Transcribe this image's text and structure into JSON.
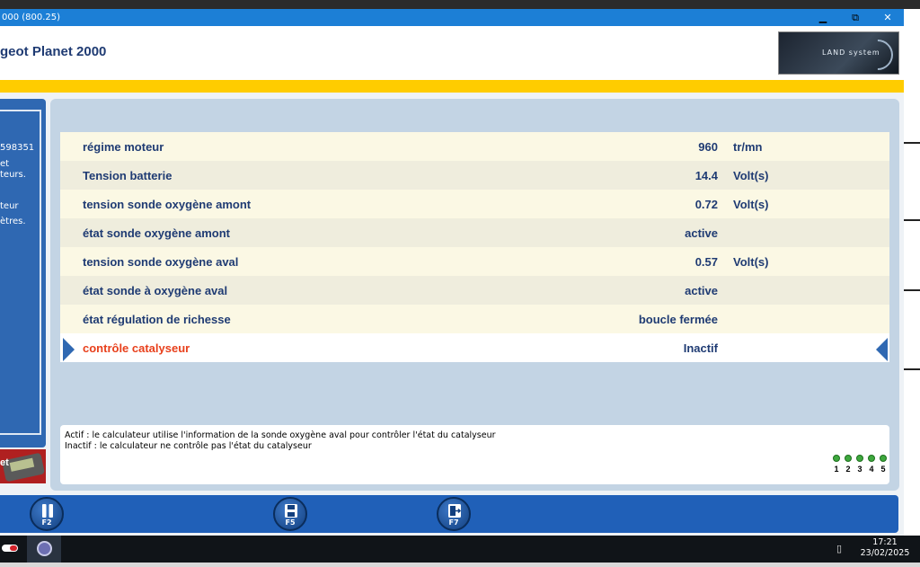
{
  "window": {
    "title": "000 (800.25)",
    "controls": {
      "minimize": "▁",
      "restore": "⧉",
      "close": "✕"
    }
  },
  "header": {
    "app_title": "geot Planet 2000",
    "logo_text": "LAND system"
  },
  "sidebar": {
    "lines": [
      "598351",
      "et",
      "teurs.",
      "",
      "teur",
      "ètres."
    ],
    "device_label": "et"
  },
  "table": {
    "rows": [
      {
        "label": "régime moteur",
        "value": "960",
        "unit": "tr/mn"
      },
      {
        "label": "Tension batterie",
        "value": "14.4",
        "unit": "Volt(s)"
      },
      {
        "label": "tension sonde oxygène amont",
        "value": "0.72",
        "unit": "Volt(s)"
      },
      {
        "label": "état sonde oxygène amont",
        "value": "active",
        "unit": ""
      },
      {
        "label": "tension sonde oxygène aval",
        "value": "0.57",
        "unit": "Volt(s)"
      },
      {
        "label": "état sonde à oxygène aval",
        "value": "active",
        "unit": ""
      },
      {
        "label": "état régulation de richesse",
        "value": "boucle fermée",
        "unit": ""
      },
      {
        "label": "contrôle catalyseur",
        "value": "Inactif",
        "unit": "",
        "selected": true
      }
    ]
  },
  "info": {
    "line1": "Actif : le calculateur utilise l'information de la sonde oxygène aval pour contrôler l'état du catalyseur",
    "line2": "Inactif : le calculateur ne contrôle pas l'état du catalyseur",
    "steps": [
      "1",
      "2",
      "3",
      "4",
      "5"
    ]
  },
  "footer": {
    "keys": [
      {
        "label": "F2",
        "icon": "pause-icon"
      },
      {
        "label": "F5",
        "icon": "save-disk-icon"
      },
      {
        "label": "F7",
        "icon": "exit-door-icon"
      }
    ]
  },
  "taskbar": {
    "time": "17:21",
    "date": "23/02/2025"
  },
  "colors": {
    "titlebar": "#1c7fd6",
    "accent_yellow": "#ffcc00",
    "panel_blue": "#2f68b2",
    "selected_label": "#e8401c",
    "text_navy": "#1f3b73"
  }
}
